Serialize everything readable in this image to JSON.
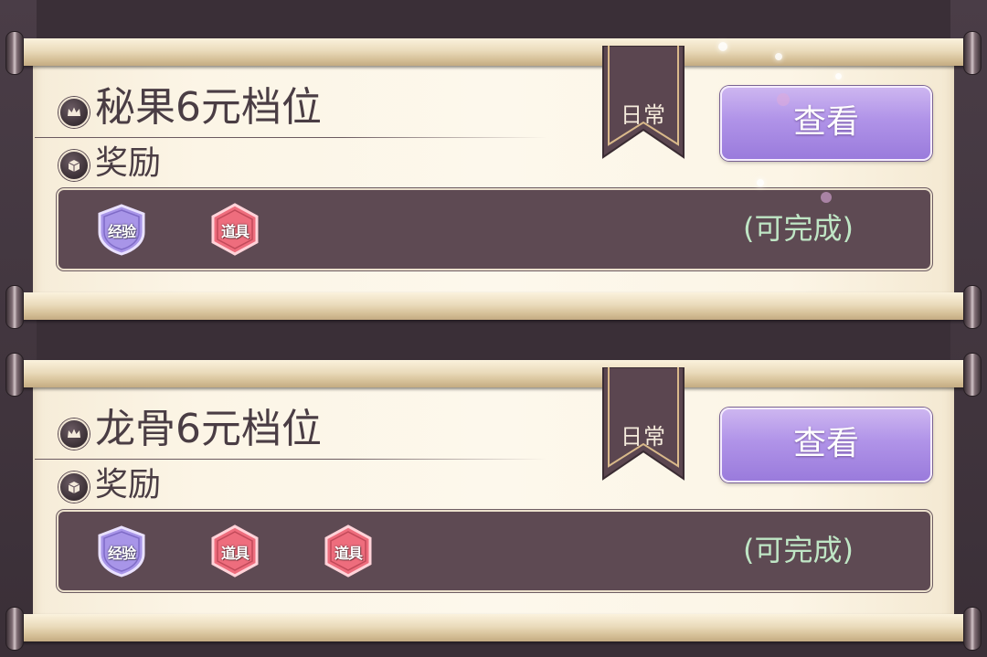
{
  "quests": [
    {
      "title": "秘果6元档位",
      "reward_label": "奖励",
      "ribbon_label": "日常",
      "view_button": "查看",
      "status": "(可完成)",
      "rewards": [
        {
          "label": "经验",
          "type": "exp",
          "color": "#a895e8"
        },
        {
          "label": "道具",
          "type": "item",
          "color": "#ee6d7d"
        }
      ]
    },
    {
      "title": "龙骨6元档位",
      "reward_label": "奖励",
      "ribbon_label": "日常",
      "view_button": "查看",
      "status": "(可完成)",
      "rewards": [
        {
          "label": "经验",
          "type": "exp",
          "color": "#a895e8"
        },
        {
          "label": "道具",
          "type": "item",
          "color": "#ee6d7d"
        },
        {
          "label": "道具",
          "type": "item",
          "color": "#ee6d7d"
        }
      ]
    }
  ],
  "icons": {
    "title": "crown-icon",
    "reward": "treasure-box-icon",
    "exp_badge": "shield-badge-icon",
    "item_badge": "hexagon-badge-icon"
  },
  "colors": {
    "background": "#3a2f37",
    "paper": "#fdf8ec",
    "button": "#b093e8",
    "reward_bar": "#5e4a53",
    "status": "#bfe6c5",
    "ribbon": "#5b4650"
  }
}
